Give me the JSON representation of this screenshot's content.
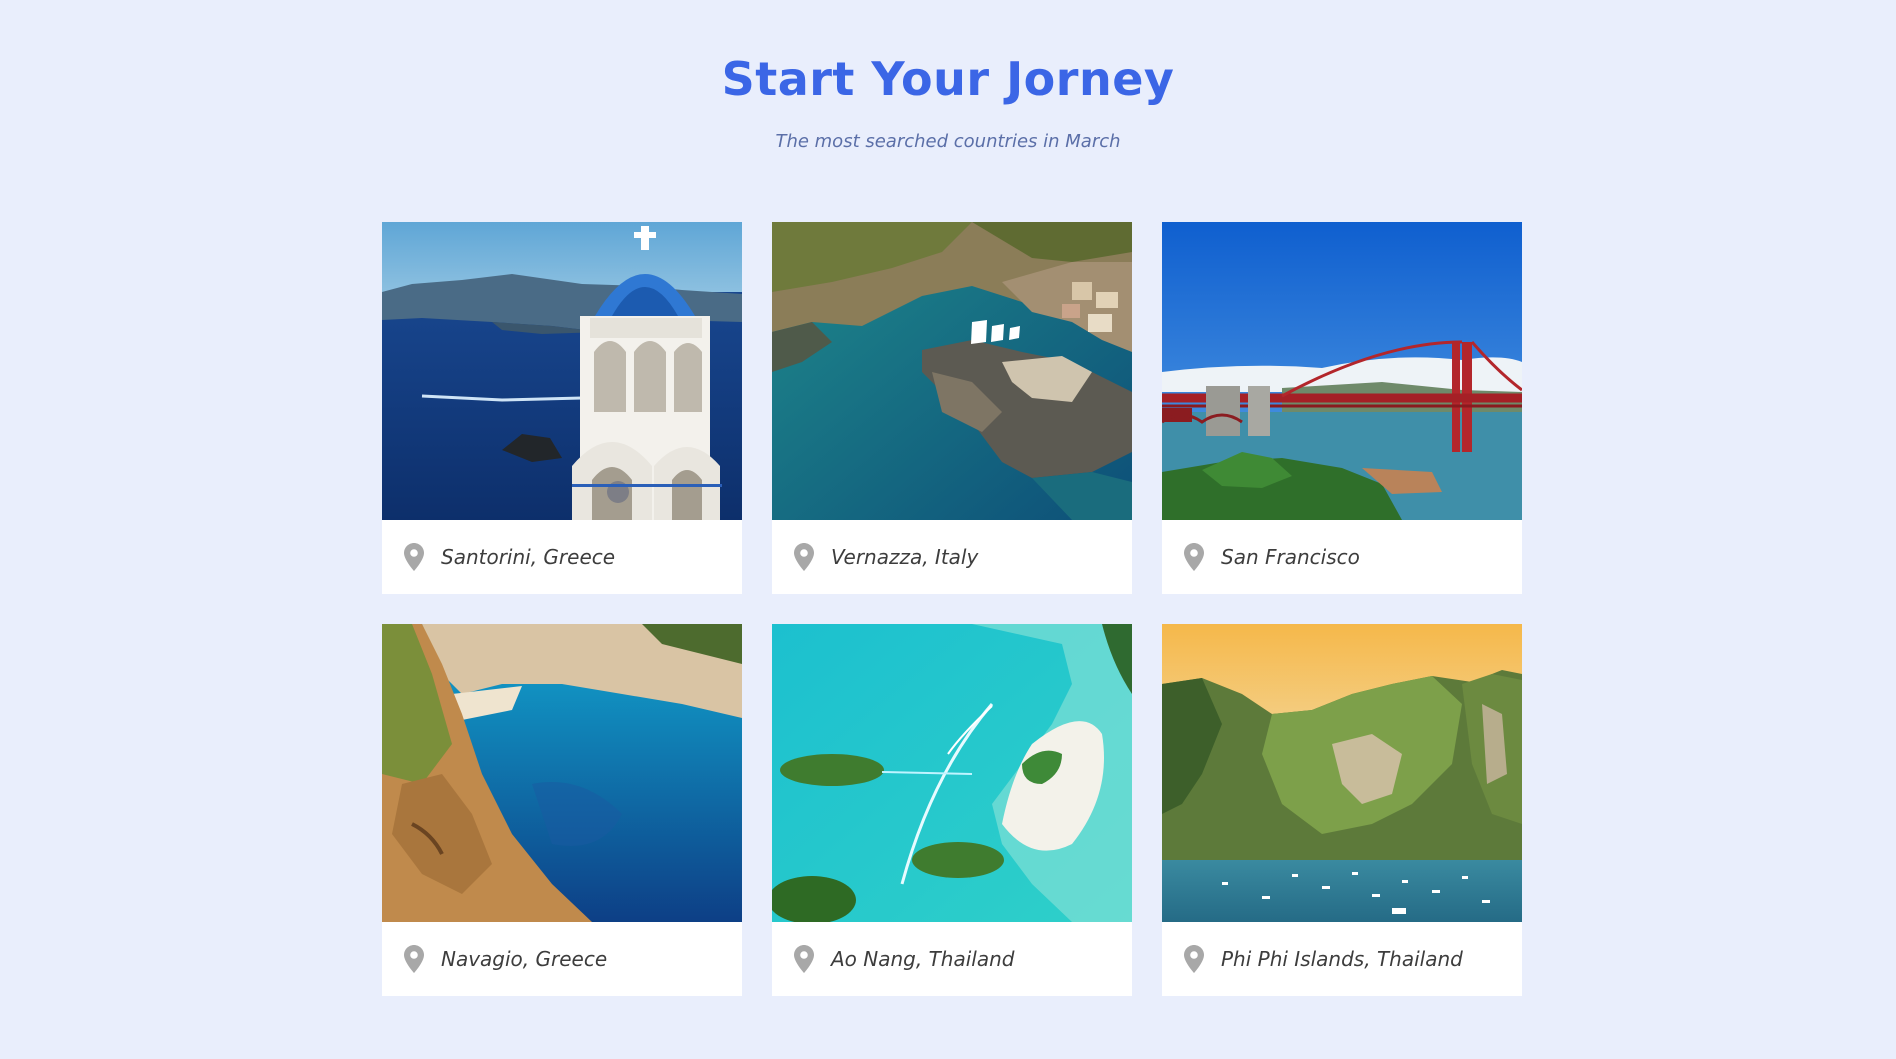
{
  "header": {
    "title": "Start Your Jorney",
    "subtitle": "The most searched countries in March"
  },
  "destinations": [
    {
      "name": "Santorini, Greece",
      "image": "santorini-photo"
    },
    {
      "name": "Vernazza, Italy",
      "image": "vernazza-photo"
    },
    {
      "name": "San Francisco",
      "image": "golden-gate-photo"
    },
    {
      "name": "Navagio, Greece",
      "image": "navagio-photo"
    },
    {
      "name": "Ao Nang, Thailand",
      "image": "ao-nang-photo"
    },
    {
      "name": "Phi Phi Islands, Thailand",
      "image": "phi-phi-photo"
    }
  ],
  "colors": {
    "accent": "#3b66e6",
    "background": "#e9eefc",
    "card": "#ffffff",
    "pin": "#a8a8a8"
  },
  "icons": {
    "location": "map-pin-icon"
  }
}
